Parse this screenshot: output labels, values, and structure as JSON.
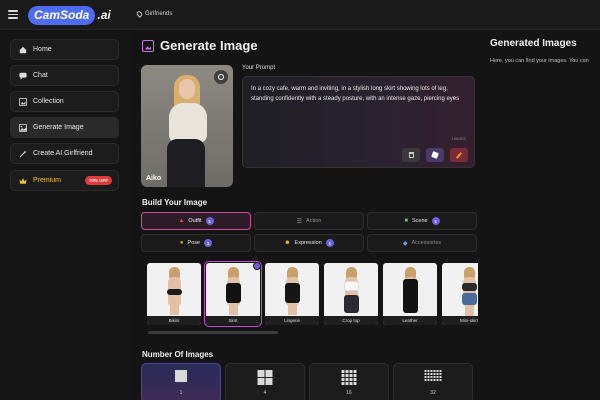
{
  "app": {
    "logo_text": "CamSoda",
    "logo_suffix": ".ai",
    "location": "Girlfriends"
  },
  "sidebar": {
    "items": [
      {
        "label": "Home",
        "icon": "home-icon"
      },
      {
        "label": "Chat",
        "icon": "chat-icon"
      },
      {
        "label": "Collection",
        "icon": "collection-icon"
      },
      {
        "label": "Generate Image",
        "icon": "image-icon",
        "active": true
      },
      {
        "label": "Create AI Girlfriend",
        "icon": "magic-wand-icon"
      }
    ],
    "premium": {
      "label": "Premium",
      "badge": "70% OFF",
      "icon": "crown-icon"
    }
  },
  "main": {
    "title": "Generate Image",
    "character_name": "Aiko",
    "prompt": {
      "label": "Your Prompt",
      "value": "In a cozy cafe, warm and inviting, in a stylish long skirt showing lots of leg, standing confidently with a steady posture, with an intense gaze, piercing eyes",
      "counter": "158/800"
    },
    "build_label": "Build Your Image",
    "tabs": [
      {
        "label": "Outfit",
        "count": "1",
        "icon": "outfit-icon",
        "active": true
      },
      {
        "label": "Action",
        "count": "",
        "icon": "action-icon"
      },
      {
        "label": "Scene",
        "count": "1",
        "icon": "scene-icon",
        "bright": true
      },
      {
        "label": "Pose",
        "count": "1",
        "icon": "pose-icon",
        "bright": true
      },
      {
        "label": "Expression",
        "count": "1",
        "icon": "expression-icon",
        "bright": true
      },
      {
        "label": "Accessories",
        "count": "",
        "icon": "diamond-icon"
      }
    ],
    "outfits": [
      {
        "label": "Bikini",
        "color": "#1b1b1b",
        "selected": false
      },
      {
        "label": "Skirt",
        "color": "#111111",
        "selected": true
      },
      {
        "label": "Lingerie",
        "color": "#151515",
        "selected": false
      },
      {
        "label": "Crop top",
        "color": "#f4f4f4",
        "selected": false
      },
      {
        "label": "Leather",
        "color": "#121212",
        "selected": false
      },
      {
        "label": "Mini-skirt",
        "color": "#4a6a9a",
        "selected": false
      }
    ],
    "number_label": "Number Of Images",
    "number_options": [
      {
        "label": "1",
        "grid": 1,
        "active": true
      },
      {
        "label": "4",
        "grid": 2,
        "active": false
      },
      {
        "label": "16",
        "grid": 3,
        "active": false
      },
      {
        "label": "32",
        "grid": 4,
        "active": false
      }
    ]
  },
  "right": {
    "title": "Generated Images",
    "subtitle": "Here, you can find your images. You can"
  },
  "colors": {
    "accent_pink": "#d24aa0",
    "accent_purple": "#6b5fe6",
    "brand_blue": "#4f6bf2",
    "premium_red": "#e23a3a"
  }
}
